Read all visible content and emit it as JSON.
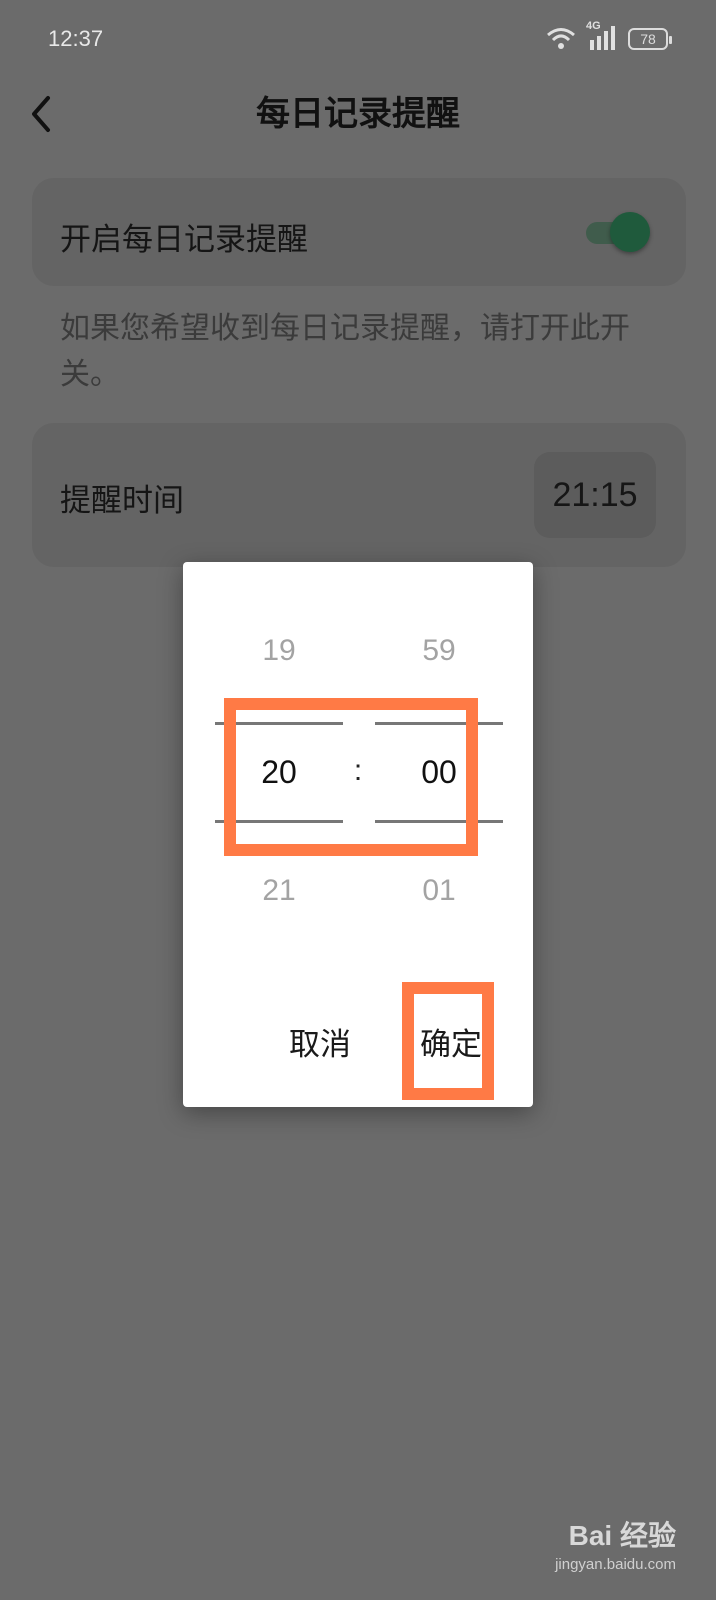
{
  "status_bar": {
    "time": "12:37",
    "network": "4G",
    "battery": "78",
    "icons": [
      "wifi-icon",
      "cellular-signal-icon",
      "battery-icon"
    ]
  },
  "header": {
    "title": "每日记录提醒",
    "back_icon": "chevron-left-icon"
  },
  "toggle_card": {
    "label": "开启每日记录提醒",
    "enabled": true
  },
  "hint_text": "如果您希望收到每日记录提醒，请打开此开关。",
  "time_card": {
    "label": "提醒时间",
    "value": "21:15"
  },
  "time_picker_dialog": {
    "hour": {
      "prev": "19",
      "current": "20",
      "next": "21"
    },
    "minute": {
      "prev": "59",
      "current": "00",
      "next": "01"
    },
    "separator": ":",
    "cancel_label": "取消",
    "confirm_label": "确定"
  },
  "watermark": {
    "logo": "Bai 经验",
    "url": "jingyan.baidu.com"
  },
  "colors": {
    "overlay_background": "#6b6b6b",
    "highlight": "#ff7a45",
    "toggle_accent": "#1f5a3c",
    "dialog_background": "#ffffff"
  }
}
